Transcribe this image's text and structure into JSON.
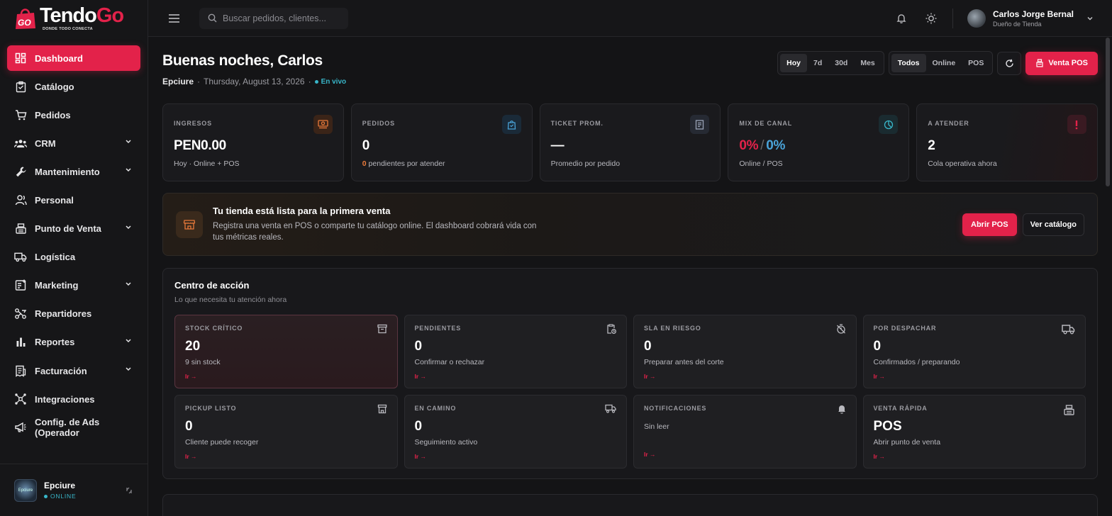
{
  "brand": {
    "name_white": "Tendo",
    "name_red": "Go",
    "tagline": "DONDE TODO CONECTA",
    "badge": "GO"
  },
  "sidebar": {
    "items": [
      {
        "label": "Dashboard",
        "icon": "dashboard-icon",
        "active": true,
        "expandable": false
      },
      {
        "label": "Catálogo",
        "icon": "catalog-icon",
        "active": false,
        "expandable": false
      },
      {
        "label": "Pedidos",
        "icon": "cart-icon",
        "active": false,
        "expandable": false
      },
      {
        "label": "CRM",
        "icon": "users-icon",
        "active": false,
        "expandable": true
      },
      {
        "label": "Mantenimiento",
        "icon": "wrench-icon",
        "active": false,
        "expandable": true
      },
      {
        "label": "Personal",
        "icon": "person-icon",
        "active": false,
        "expandable": false
      },
      {
        "label": "Punto de Venta",
        "icon": "register-icon",
        "active": false,
        "expandable": true
      },
      {
        "label": "Logística",
        "icon": "truck-icon",
        "active": false,
        "expandable": false
      },
      {
        "label": "Marketing",
        "icon": "marketing-icon",
        "active": false,
        "expandable": true
      },
      {
        "label": "Repartidores",
        "icon": "delivery-icon",
        "active": false,
        "expandable": false
      },
      {
        "label": "Reportes",
        "icon": "bar-chart-icon",
        "active": false,
        "expandable": true
      },
      {
        "label": "Facturación",
        "icon": "invoice-icon",
        "active": false,
        "expandable": true
      },
      {
        "label": "Integraciones",
        "icon": "integrations-icon",
        "active": false,
        "expandable": false
      },
      {
        "label": "Config. de Ads (Operador",
        "icon": "megaphone-icon",
        "active": false,
        "expandable": false
      }
    ],
    "store": {
      "name": "Epciure",
      "status": "ONLINE",
      "avatar_text": "Epciure"
    }
  },
  "topbar": {
    "search_placeholder": "Buscar pedidos, clientes...",
    "user_name": "Carlos Jorge Bernal",
    "user_role": "Dueño de Tienda"
  },
  "header": {
    "greeting": "Buenas noches, Carlos",
    "store": "Epciure",
    "date": "Thursday, August 13, 2026",
    "live": "En vivo",
    "periods": [
      "Hoy",
      "7d",
      "30d",
      "Mes"
    ],
    "active_period": "Hoy",
    "channels": [
      "Todos",
      "Online",
      "POS"
    ],
    "active_channel": "Todos",
    "pos_button": "Venta POS"
  },
  "kpis": [
    {
      "label": "INGRESOS",
      "value": "PEN0.00",
      "sub": "Hoy · Online + POS",
      "icon": "cash-icon",
      "icon_color": "#e8793a",
      "icon_bg": "#3a2418"
    },
    {
      "label": "PEDIDOS",
      "value": "0",
      "sub_highlight": "0",
      "sub": " pendientes por atender",
      "icon": "bag-icon",
      "icon_color": "#4aa3d8",
      "icon_bg": "#1a2a38"
    },
    {
      "label": "TICKET PROM.",
      "value": "—",
      "sub": "Promedio por pedido",
      "icon": "receipt-icon",
      "icon_color": "#9aa4b8",
      "icon_bg": "#262a33"
    },
    {
      "label": "MIX DE CANAL",
      "value_online": "0%",
      "value_sep": "/",
      "value_pos": "0%",
      "sub": "Online / POS",
      "icon": "pie-icon",
      "icon_color": "#38b6c9",
      "icon_bg": "#1a2b30"
    },
    {
      "label": "A ATENDER",
      "value": "2",
      "sub": "Cola operativa ahora",
      "icon": "alert-icon",
      "icon_color": "#e3224a",
      "icon_bg": "#3a1a22"
    }
  ],
  "banner": {
    "title": "Tu tienda está lista para la primera venta",
    "desc": "Registra una venta en POS o comparte tu catálogo online. El dashboard cobrará vida con tus métricas reales.",
    "primary": "Abrir POS",
    "secondary": "Ver catálogo"
  },
  "action_center": {
    "title": "Centro de acción",
    "subtitle": "Lo que necesita tu atención ahora",
    "cards": [
      {
        "label": "STOCK CRÍTICO",
        "value": "20",
        "desc": "9 sin stock",
        "link": "Ir →",
        "icon": "archive-icon",
        "hot": true
      },
      {
        "label": "PENDIENTES",
        "value": "0",
        "desc": "Confirmar o rechazar",
        "link": "Ir →",
        "icon": "clipboard-clock-icon",
        "hot": false
      },
      {
        "label": "SLA EN RIESGO",
        "value": "0",
        "desc": "Preparar antes del corte",
        "link": "Ir →",
        "icon": "timer-off-icon",
        "hot": false
      },
      {
        "label": "POR DESPACHAR",
        "value": "0",
        "desc": "Confirmados / preparando",
        "link": "Ir →",
        "icon": "truck-icon",
        "hot": false
      },
      {
        "label": "PICKUP LISTO",
        "value": "0",
        "desc": "Cliente puede recoger",
        "link": "Ir →",
        "icon": "store-icon",
        "hot": false
      },
      {
        "label": "EN CAMINO",
        "value": "0",
        "desc": "Seguimiento activo",
        "link": "Ir →",
        "icon": "delivery-truck-icon",
        "hot": false
      },
      {
        "label": "NOTIFICACIONES",
        "value": "",
        "desc": "Sin leer",
        "link": "Ir →",
        "icon": "bell-icon",
        "hot": false
      },
      {
        "label": "VENTA RÁPIDA",
        "value": "POS",
        "desc": "Abrir punto de venta",
        "link": "Ir →",
        "icon": "register-icon",
        "hot": false
      }
    ]
  },
  "colors": {
    "accent": "#e3224a",
    "cyan": "#38b6c9",
    "bg": "#141416"
  }
}
